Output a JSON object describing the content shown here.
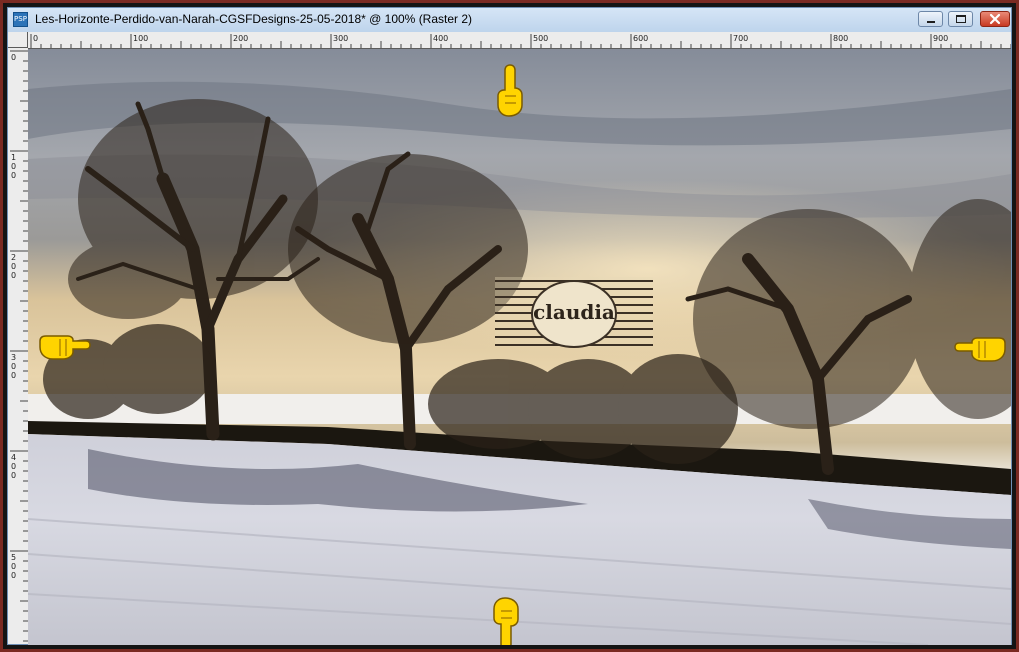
{
  "window": {
    "title": "Les-Horizonte-Perdido-van-Narah-CGSFDesigns-25-05-2018* @ 100% (Raster 2)",
    "app_icon_text": "PSP",
    "minimize_icon": "minimize-icon",
    "maximize_icon": "maximize-icon",
    "close_icon": "close-icon"
  },
  "ruler": {
    "top_labels": [
      "0",
      "100",
      "200",
      "300",
      "400",
      "500",
      "600",
      "700",
      "800",
      "900"
    ],
    "left_labels": [
      "0",
      "100",
      "200",
      "300",
      "400",
      "500"
    ]
  },
  "canvas": {
    "watermark_text": "claudia",
    "pointers": [
      {
        "direction": "down",
        "icon": "hand-pointing-down-icon"
      },
      {
        "direction": "right",
        "icon": "hand-pointing-right-icon"
      },
      {
        "direction": "left",
        "icon": "hand-pointing-left-icon"
      },
      {
        "direction": "up",
        "icon": "hand-pointing-up-icon"
      }
    ]
  },
  "colors": {
    "frame": "#7a2a22",
    "titlebar": "#bed4ec",
    "close_button": "#c83a23",
    "pointer_hand": "#ffd400",
    "sky_top": "#8c93a0",
    "sky_glow": "#e6cf9e",
    "snow": "#d7d8e0",
    "tree": "#2a2118"
  }
}
